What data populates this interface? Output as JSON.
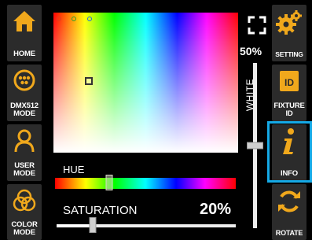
{
  "left_nav": [
    {
      "id": "home",
      "label": "HOME",
      "icon": "home-icon"
    },
    {
      "id": "dmx512",
      "label": "DMX512 MODE",
      "icon": "dmx-connector-icon"
    },
    {
      "id": "user",
      "label": "USER MODE",
      "icon": "user-icon"
    },
    {
      "id": "color",
      "label": "COLOR MODE",
      "icon": "color-circles-icon"
    }
  ],
  "right_nav": [
    {
      "id": "settings",
      "label": "SETTING",
      "icon": "gear-icon"
    },
    {
      "id": "fixture",
      "label": "FIXTURE ID",
      "icon": "id-card-icon"
    },
    {
      "id": "info",
      "label": "INFO",
      "icon": "info-icon",
      "selected": true
    },
    {
      "id": "rotate",
      "label": "ROTATE",
      "icon": "rotate-icon"
    }
  ],
  "hue": {
    "label": "HUE",
    "level": 0.3
  },
  "saturation": {
    "label": "SATURATION",
    "value": "20%",
    "level": 0.2
  },
  "white": {
    "label": "WHITE",
    "value": "50%",
    "level": 0.5
  },
  "colors": {
    "accent": "#15a9e6",
    "icon": "#f0a81c",
    "button_bg": "#2b2b2b"
  },
  "indicator_dots": [
    "#e04020",
    "#2ea02e",
    "#2070e0"
  ]
}
